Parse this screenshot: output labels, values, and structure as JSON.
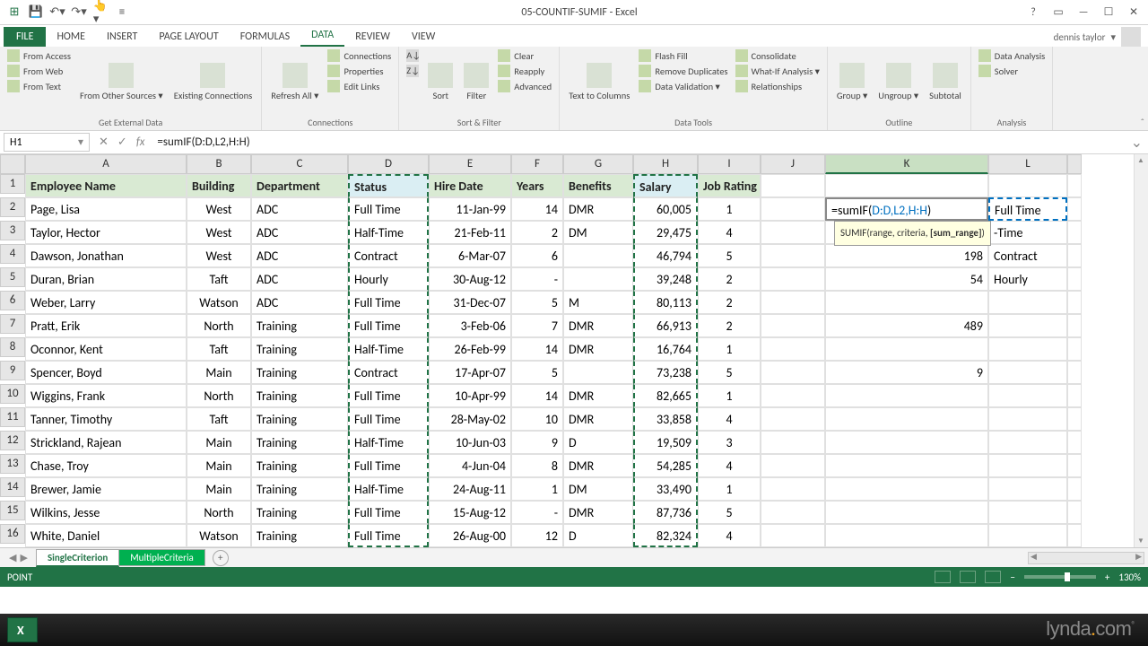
{
  "title": "05-COUNTIF-SUMIF - Excel",
  "user": "dennis taylor",
  "tabs": {
    "file": "FILE",
    "list": [
      "HOME",
      "INSERT",
      "PAGE LAYOUT",
      "FORMULAS",
      "DATA",
      "REVIEW",
      "VIEW"
    ],
    "active": "DATA"
  },
  "ribbon": {
    "g1": {
      "items": [
        "From Access",
        "From Web",
        "From Text"
      ],
      "big": "From Other Sources ▾",
      "big2": "Existing Connections",
      "label": "Get External Data"
    },
    "g2": {
      "big": "Refresh All ▾",
      "items": [
        "Connections",
        "Properties",
        "Edit Links"
      ],
      "label": "Connections"
    },
    "g3": {
      "sort": "Sort",
      "filter": "Filter",
      "items": [
        "Clear",
        "Reapply",
        "Advanced"
      ],
      "label": "Sort & Filter"
    },
    "g4": {
      "big": "Text to Columns",
      "items": [
        "Flash Fill",
        "Remove Duplicates",
        "Data Validation ▾",
        "Consolidate",
        "What-If Analysis ▾",
        "Relationships"
      ],
      "label": "Data Tools"
    },
    "g5": {
      "items": [
        "Group ▾",
        "Ungroup ▾",
        "Subtotal"
      ],
      "label": "Outline"
    },
    "g6": {
      "items": [
        "Data Analysis",
        "Solver"
      ],
      "label": "Analysis"
    }
  },
  "namebox": "H1",
  "formula": "=sumIF(D:D,L2,H:H)",
  "edit_formula_pre": "=sumIF(",
  "edit_formula_args": "D:D,L2,H:H",
  "edit_formula_post": ")",
  "tooltip": "SUMIF(range, criteria, [sum_range])",
  "columns": [
    "A",
    "B",
    "C",
    "D",
    "E",
    "F",
    "G",
    "H",
    "I",
    "J",
    "K",
    "L"
  ],
  "headers": [
    "Employee Name",
    "Building",
    "Department",
    "Status",
    "Hire Date",
    "Years",
    "Benefits",
    "Salary",
    "Job Rating"
  ],
  "rows": [
    {
      "n": 1
    },
    {
      "n": 2,
      "a": "Page, Lisa",
      "b": "West",
      "c": "ADC",
      "d": "Full Time",
      "e": "11-Jan-99",
      "f": "14",
      "g": "DMR",
      "h": "60,005",
      "i": "1",
      "k": "",
      "l": "Full Time"
    },
    {
      "n": 3,
      "a": "Taylor, Hector",
      "b": "West",
      "c": "ADC",
      "d": "Half-Time",
      "e": "21-Feb-11",
      "f": "2",
      "g": "DM",
      "h": "29,475",
      "i": "4",
      "k": "",
      "l": "-Time"
    },
    {
      "n": 4,
      "a": "Dawson, Jonathan",
      "b": "West",
      "c": "ADC",
      "d": "Contract",
      "e": "6-Mar-07",
      "f": "6",
      "g": "",
      "h": "46,794",
      "i": "5",
      "k": "198",
      "l": "Contract"
    },
    {
      "n": 5,
      "a": "Duran, Brian",
      "b": "Taft",
      "c": "ADC",
      "d": "Hourly",
      "e": "30-Aug-12",
      "f": "-",
      "g": "",
      "h": "39,248",
      "i": "2",
      "k": "54",
      "l": "Hourly"
    },
    {
      "n": 6,
      "a": "Weber, Larry",
      "b": "Watson",
      "c": "ADC",
      "d": "Full Time",
      "e": "31-Dec-07",
      "f": "5",
      "g": "M",
      "h": "80,113",
      "i": "2",
      "k": "",
      "l": ""
    },
    {
      "n": 7,
      "a": "Pratt, Erik",
      "b": "North",
      "c": "Training",
      "d": "Full Time",
      "e": "3-Feb-06",
      "f": "7",
      "g": "DMR",
      "h": "66,913",
      "i": "2",
      "k": "489",
      "l": ""
    },
    {
      "n": 8,
      "a": "Oconnor, Kent",
      "b": "Taft",
      "c": "Training",
      "d": "Half-Time",
      "e": "26-Feb-99",
      "f": "14",
      "g": "DMR",
      "h": "16,764",
      "i": "1",
      "k": "",
      "l": ""
    },
    {
      "n": 9,
      "a": "Spencer, Boyd",
      "b": "Main",
      "c": "Training",
      "d": "Contract",
      "e": "17-Apr-07",
      "f": "5",
      "g": "",
      "h": "73,238",
      "i": "5",
      "k": "9",
      "l": ""
    },
    {
      "n": 10,
      "a": "Wiggins, Frank",
      "b": "North",
      "c": "Training",
      "d": "Full Time",
      "e": "10-Apr-99",
      "f": "14",
      "g": "DMR",
      "h": "82,665",
      "i": "1",
      "k": "",
      "l": ""
    },
    {
      "n": 11,
      "a": "Tanner, Timothy",
      "b": "Taft",
      "c": "Training",
      "d": "Full Time",
      "e": "28-May-02",
      "f": "10",
      "g": "DMR",
      "h": "33,858",
      "i": "4",
      "k": "",
      "l": ""
    },
    {
      "n": 12,
      "a": "Strickland, Rajean",
      "b": "Main",
      "c": "Training",
      "d": "Half-Time",
      "e": "10-Jun-03",
      "f": "9",
      "g": "D",
      "h": "19,509",
      "i": "3",
      "k": "",
      "l": ""
    },
    {
      "n": 13,
      "a": "Chase, Troy",
      "b": "Main",
      "c": "Training",
      "d": "Full Time",
      "e": "4-Jun-04",
      "f": "8",
      "g": "DMR",
      "h": "54,285",
      "i": "4",
      "k": "",
      "l": ""
    },
    {
      "n": 14,
      "a": "Brewer, Jamie",
      "b": "Main",
      "c": "Training",
      "d": "Half-Time",
      "e": "24-Aug-11",
      "f": "1",
      "g": "DM",
      "h": "33,490",
      "i": "1",
      "k": "",
      "l": ""
    },
    {
      "n": 15,
      "a": "Wilkins, Jesse",
      "b": "North",
      "c": "Training",
      "d": "Full Time",
      "e": "15-Aug-12",
      "f": "-",
      "g": "DMR",
      "h": "87,736",
      "i": "5",
      "k": "",
      "l": ""
    },
    {
      "n": 16,
      "a": "White, Daniel",
      "b": "Watson",
      "c": "Training",
      "d": "Full Time",
      "e": "26-Aug-00",
      "f": "12",
      "g": "D",
      "h": "82,324",
      "i": "4",
      "k": "",
      "l": ""
    }
  ],
  "sheets": {
    "active": "SingleCriterion",
    "other": "MultipleCriteria"
  },
  "status": "POINT",
  "zoom": "130%",
  "brand": "lynda.com"
}
